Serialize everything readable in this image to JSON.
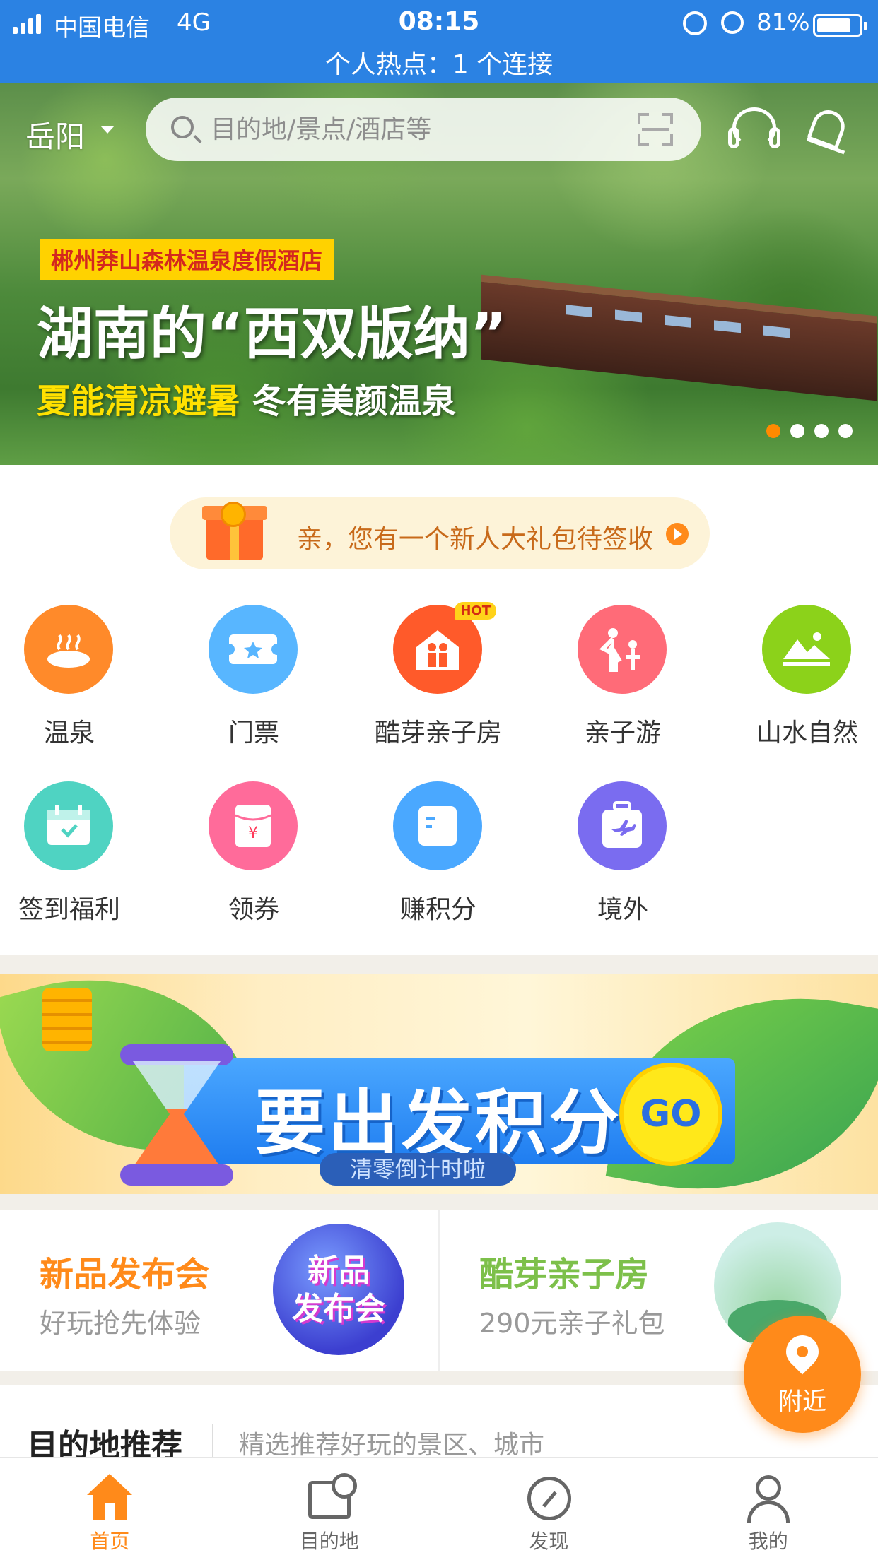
{
  "status_bar": {
    "carrier": "中国电信",
    "network": "4G",
    "time": "08:15",
    "battery": "81%",
    "battery_level": 0.81,
    "hotspot": "个人热点：1 个连接"
  },
  "header": {
    "city": "岳阳",
    "search_placeholder": "目的地/景点/酒店等"
  },
  "hero": {
    "tag": "郴州莽山森林温泉度假酒店",
    "headline": "湖南的“西双版纳”",
    "sub_highlight": "夏能清凉避暑",
    "sub_rest": " 冬有美颜温泉",
    "page_count": 4,
    "active_page": 1
  },
  "gift_bar": {
    "text": "亲，您有一个新人大礼包待签收"
  },
  "categories": [
    {
      "label": "温泉",
      "color": "#ff8a2a"
    },
    {
      "label": "门票",
      "color": "#58b6ff"
    },
    {
      "label": "酷芽亲子房",
      "color": "#ff5a2a",
      "badge": "HOT"
    },
    {
      "label": "亲子游",
      "color": "#ff6b78"
    },
    {
      "label": "山水自然",
      "color": "#8cd21a"
    },
    {
      "label": "签到福利",
      "color": "#4fd3c2"
    },
    {
      "label": "领券",
      "color": "#ff6b9a"
    },
    {
      "label": "赚积分",
      "color": "#4aa8ff"
    },
    {
      "label": "境外",
      "color": "#7a6cf0"
    }
  ],
  "points_banner": {
    "title": "要出发积分",
    "subtitle": "清零倒计时啦",
    "go": "GO"
  },
  "promos": [
    {
      "title": "新品发布会",
      "subtitle": "好玩抢先体验",
      "art": "新品\n发布会"
    },
    {
      "title": "酷芽亲子房",
      "subtitle": "290元亲子礼包"
    }
  ],
  "nearby": {
    "label": "附近"
  },
  "destinations": {
    "title": "目的地推荐",
    "subtitle": "精选推荐好玩的景区、城市"
  },
  "tabbar": [
    {
      "label": "首页",
      "active": true
    },
    {
      "label": "目的地",
      "active": false
    },
    {
      "label": "发现",
      "active": false
    },
    {
      "label": "我的",
      "active": false
    }
  ]
}
